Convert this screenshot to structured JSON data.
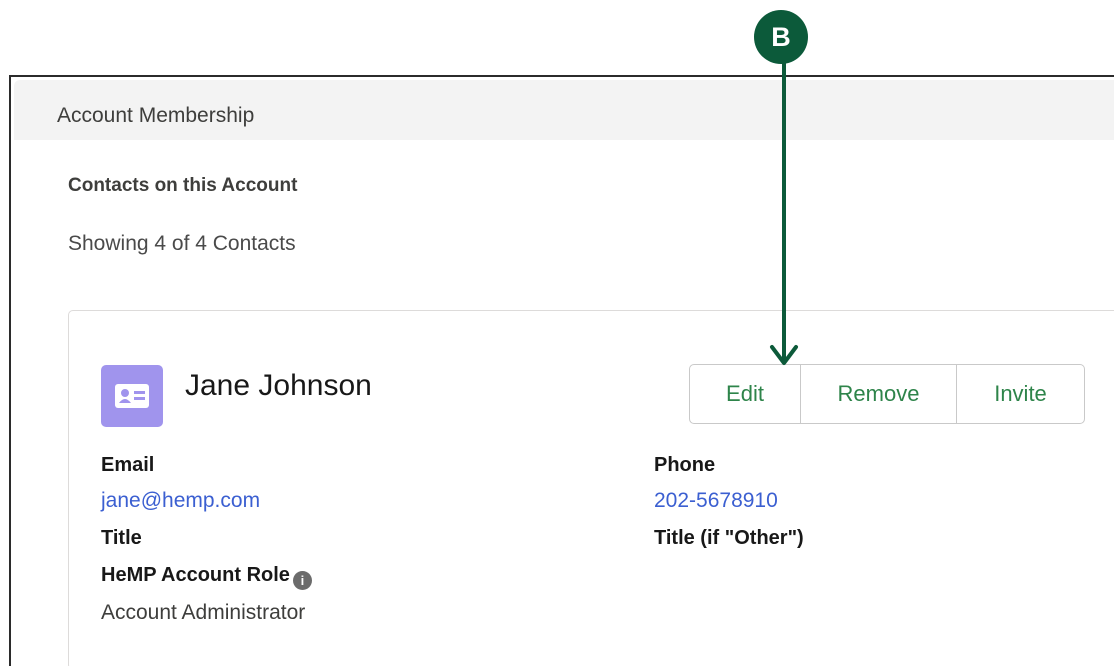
{
  "section": {
    "title": "Account Membership"
  },
  "contacts": {
    "heading": "Contacts on this Account",
    "showing": "Showing 4 of 4 Contacts"
  },
  "contact_card": {
    "avatar_icon": "contact-card-icon",
    "name": "Jane Johnson",
    "buttons": {
      "edit": "Edit",
      "remove": "Remove",
      "invite": "Invite"
    },
    "fields": {
      "email_label": "Email",
      "email_value": "jane@hemp.com",
      "phone_label": "Phone",
      "phone_value": "202-5678910",
      "title_label": "Title",
      "title_other_label": "Title (if \"Other\")",
      "role_label": "HeMP Account Role",
      "role_info_icon": "info-icon",
      "role_value": "Account Administrator"
    }
  },
  "callout": {
    "label": "B",
    "color": "#0c5a3a"
  },
  "colors": {
    "accent_green": "#2e844a",
    "link_blue": "#3b5fd1",
    "avatar_purple": "#a094ed"
  }
}
